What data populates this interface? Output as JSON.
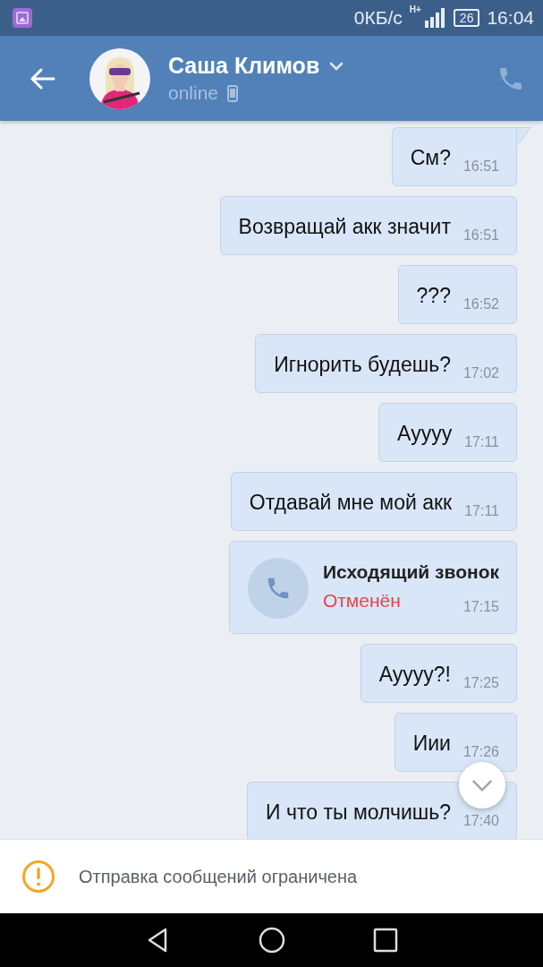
{
  "status_bar": {
    "speed": "0КБ/с",
    "network": "H+",
    "battery": "26",
    "time": "16:04"
  },
  "header": {
    "name": "Саша Климов",
    "presence": "online"
  },
  "messages": [
    {
      "kind": "text",
      "text": "См?",
      "time": "16:51",
      "tail": true
    },
    {
      "kind": "text",
      "text": "Возвращай акк значит",
      "time": "16:51",
      "tail": false
    },
    {
      "kind": "text",
      "text": "???",
      "time": "16:52",
      "tail": false
    },
    {
      "kind": "text",
      "text": "Игнорить будешь?",
      "time": "17:02",
      "tail": false
    },
    {
      "kind": "text",
      "text": "Ауууу",
      "time": "17:11",
      "tail": false
    },
    {
      "kind": "text",
      "text": "Отдавай мне мой акк",
      "time": "17:11",
      "tail": false
    },
    {
      "kind": "call",
      "title": "Исходящий звонок",
      "status": "Отменён",
      "time": "17:15",
      "tail": false
    },
    {
      "kind": "text",
      "text": "Ауууу?!",
      "time": "17:25",
      "tail": false
    },
    {
      "kind": "text",
      "text": "Иии",
      "time": "17:26",
      "tail": false
    },
    {
      "kind": "text",
      "text": "И что ты молчишь?",
      "time": "17:40",
      "tail": false
    }
  ],
  "notice": "Отправка сообщений ограничена"
}
